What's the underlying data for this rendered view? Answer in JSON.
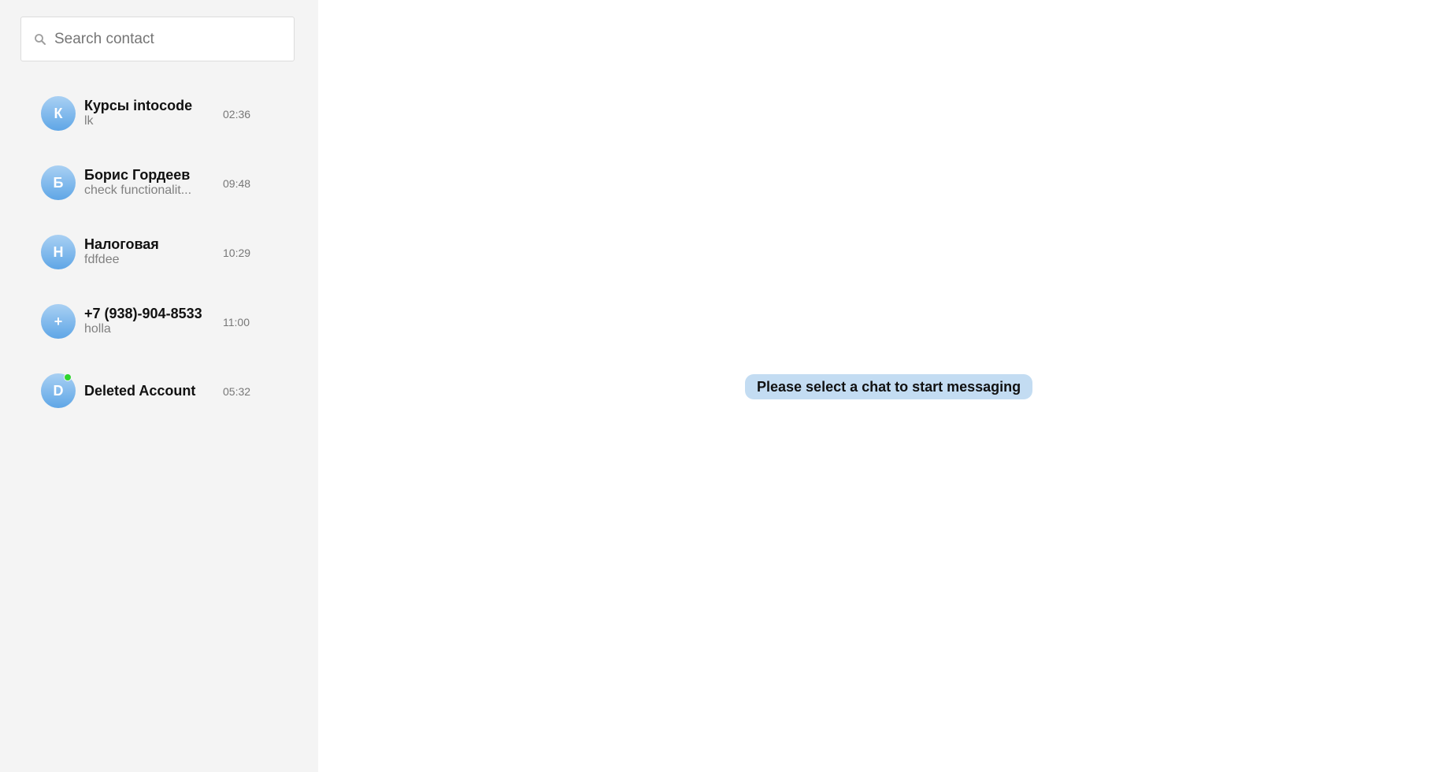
{
  "search": {
    "placeholder": "Search contact",
    "value": ""
  },
  "chats": [
    {
      "initial": "К",
      "name": "Курсы intocode",
      "preview": "lk",
      "time": "02:36",
      "online": false
    },
    {
      "initial": "Б",
      "name": "Борис Гордеев",
      "preview": "check functionalit...",
      "time": "09:48",
      "online": false
    },
    {
      "initial": "Н",
      "name": "Налоговая",
      "preview": "fdfdee",
      "time": "10:29",
      "online": false
    },
    {
      "initial": "+",
      "name": "+7 (938)-904-8533",
      "preview": "holla",
      "time": "11:00",
      "online": false
    },
    {
      "initial": "D",
      "name": "Deleted Account",
      "preview": "",
      "time": "05:32",
      "online": true
    }
  ],
  "main": {
    "empty_message": "Please select a chat to start messaging"
  },
  "colors": {
    "sidebar_bg": "#f4f4f4",
    "avatar_gradient_top": "#a9d0f3",
    "avatar_gradient_bottom": "#5fa6e6",
    "online_dot": "#2fd52f",
    "badge_bg": "#c3dcf2"
  }
}
